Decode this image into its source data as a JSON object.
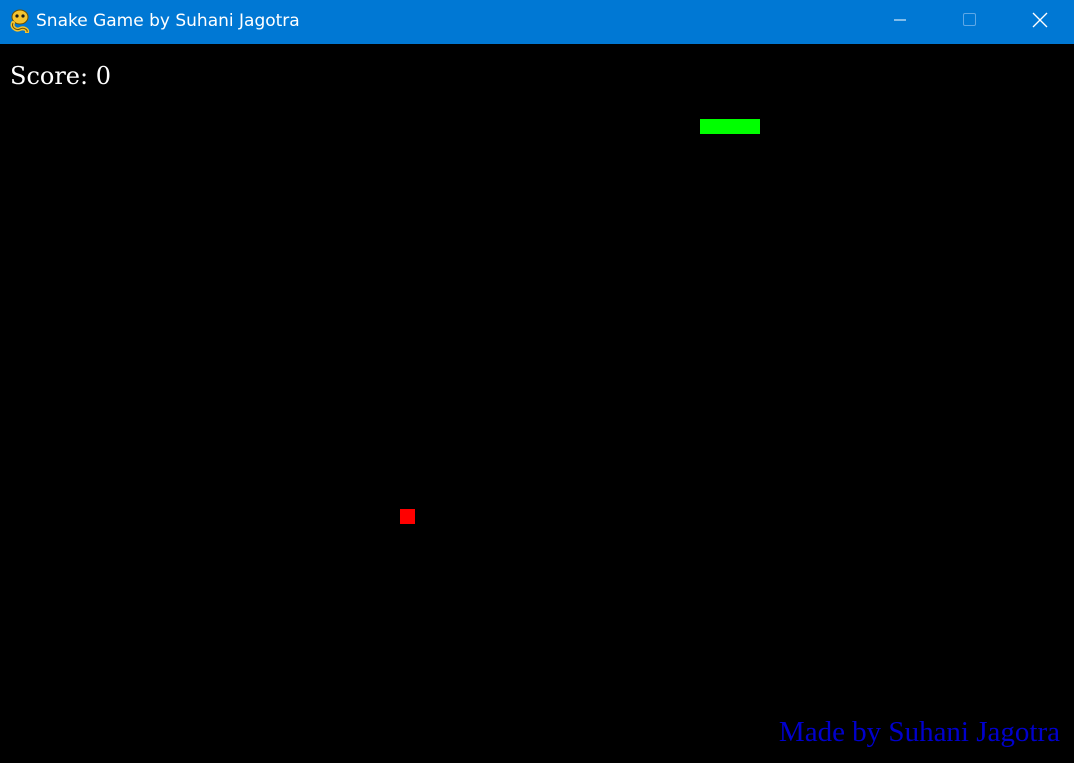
{
  "window": {
    "title": "Snake Game by Suhani Jagotra",
    "app_icon": "pygame-snake-icon",
    "controls": {
      "minimize_icon": "minimize-icon",
      "maximize_icon": "maximize-icon",
      "close_icon": "close-icon"
    },
    "titlebar_color": "#0078d4"
  },
  "game": {
    "score_text": "Score: 0",
    "snake_color": "#00ff00",
    "food_color": "#ff0000",
    "background_color": "#000000",
    "credit_text": "Made by Suhani Jagotra",
    "credit_color": "#0000cd"
  }
}
